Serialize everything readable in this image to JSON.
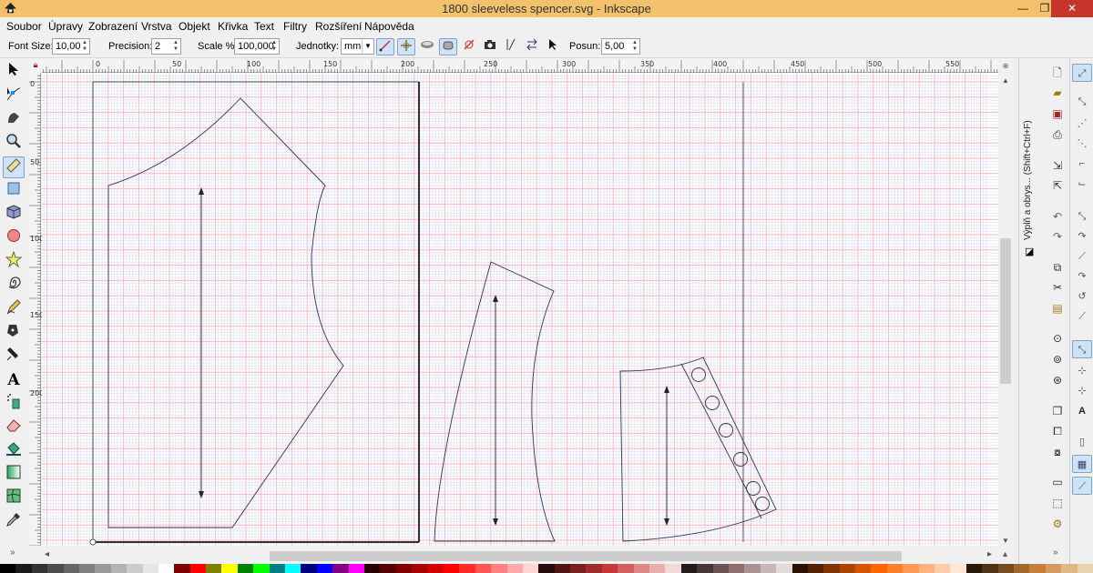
{
  "window": {
    "title": "1800 sleeveless spencer.svg - Inkscape",
    "minimize": "—",
    "maximize": "❐",
    "close": "✕"
  },
  "menu": [
    "Soubor",
    "Úpravy",
    "Zobrazení",
    "Vrstva",
    "Objekt",
    "Křivka",
    "Text",
    "Filtry",
    "Rozšíření",
    "Nápověda"
  ],
  "controls": {
    "font_size_label": "Font Size:",
    "font_size_value": "10,00",
    "precision_label": "Precision:",
    "precision_value": "2",
    "scale_label": "Scale %:",
    "scale_value": "100,000",
    "units_label": "Jednotky:",
    "units_value": "mm",
    "offset_label": "Posun:",
    "offset_value": "5,00"
  },
  "ruler": {
    "top_labels": [
      "0",
      "50",
      "100",
      "150",
      "200",
      "250",
      "300",
      "350",
      "400",
      "450",
      "500",
      "550"
    ],
    "left_labels": [
      "0",
      "50",
      "100",
      "150",
      "200"
    ]
  },
  "dock": {
    "panel_title": "Výplň a obrys... (Shift+Ctrl+F)"
  },
  "palette_colors": [
    "#000000",
    "#1a1a1a",
    "#333333",
    "#4d4d4d",
    "#666666",
    "#808080",
    "#999999",
    "#b3b3b3",
    "#cccccc",
    "#e6e6e6",
    "#ffffff",
    "#800000",
    "#ff0000",
    "#808000",
    "#ffff00",
    "#008000",
    "#00ff00",
    "#008080",
    "#00ffff",
    "#000080",
    "#0000ff",
    "#800080",
    "#ff00ff",
    "#2b0000",
    "#550000",
    "#800000",
    "#aa0000",
    "#d40000",
    "#ff0000",
    "#ff2a2a",
    "#ff5555",
    "#ff8080",
    "#ffaaaa",
    "#ffd5d5",
    "#280b0b",
    "#501616",
    "#782121",
    "#a02c2c",
    "#c83737",
    "#d35f5f",
    "#de8787",
    "#e9afaf",
    "#f4d7d7",
    "#241c1c",
    "#483737",
    "#6c5353",
    "#916f6f",
    "#ac9393",
    "#c8b7b7",
    "#e3dbdb",
    "#2b1100",
    "#552200",
    "#803300",
    "#aa4400",
    "#d45500",
    "#ff6600",
    "#ff7f2a",
    "#ff9955",
    "#ffb380",
    "#ffccaa",
    "#ffe6d5",
    "#281a0b",
    "#503416",
    "#784e21",
    "#a0682c",
    "#c87f37",
    "#d39b5f",
    "#deb887",
    "#e9d3af"
  ]
}
